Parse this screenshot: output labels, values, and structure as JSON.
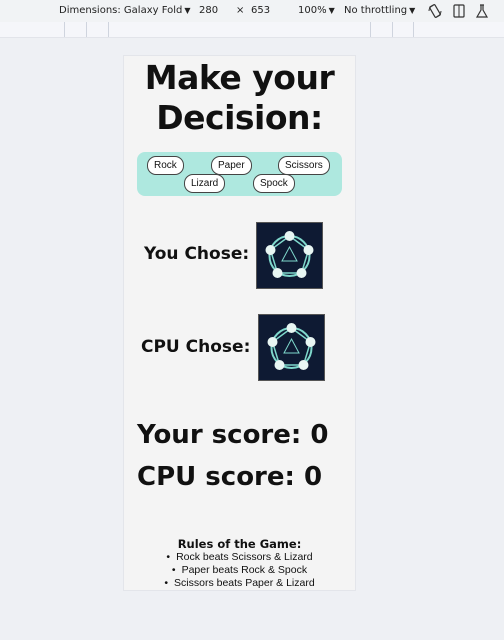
{
  "devtools": {
    "dimensions_label": "Dimensions: Galaxy Fold",
    "width": "280",
    "times": "×",
    "height": "653",
    "zoom": "100%",
    "throttling": "No throttling"
  },
  "game": {
    "heading_line1": "Make your",
    "heading_line2": "Decision:",
    "choices": [
      "Rock",
      "Paper",
      "Scissors",
      "Lizard",
      "Spock"
    ],
    "you_chose_label": "You Chose:",
    "cpu_chose_label": "CPU Chose:",
    "your_score": "Your score: 0",
    "cpu_score": "CPU score: 0",
    "rules_title": "Rules of the Game:",
    "rules": [
      "Rock beats Scissors & Lizard",
      "Paper beats Rock & Spock",
      "Scissors beats Paper & Lizard"
    ]
  },
  "colors": {
    "choices_bg": "#aee8df",
    "image_bg": "#0e1a33",
    "diagram_teal": "#7fd8cc"
  }
}
